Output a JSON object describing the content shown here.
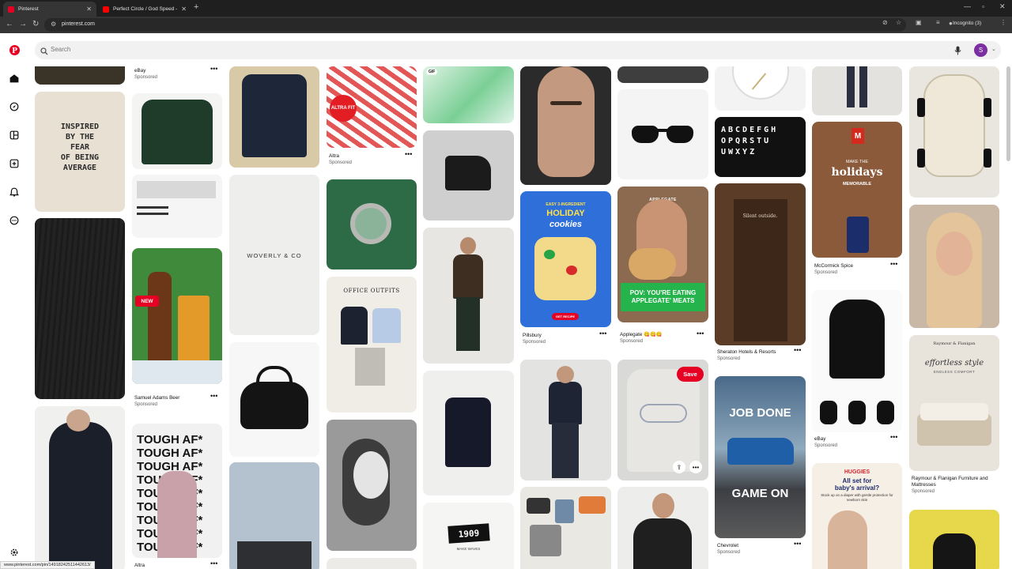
{
  "browser": {
    "tabs": [
      {
        "title": "Pinterest",
        "active": true
      },
      {
        "title": "Perfect Circle / God Speed - Yo",
        "active": false
      }
    ],
    "url": "pinterest.com",
    "incognito_label": "Incognito (3)",
    "status_url": "www.pinterest.com/pin/14918242511442613/"
  },
  "search": {
    "placeholder": "Search"
  },
  "user": {
    "initial": "S"
  },
  "pins": {
    "ebay_top": {
      "title": "eBay",
      "sub": "Sponsored"
    },
    "inspired": {
      "line1": "INSPIRED",
      "line2": "BY THE",
      "line3": "FEAR",
      "line4": "OF BEING",
      "line5": "AVERAGE"
    },
    "sam_adams": {
      "title": "Samuel Adams Beer",
      "sub": "Sponsored",
      "badge": "NEW"
    },
    "woverly": {
      "text": "WOVERLY & CO"
    },
    "altra_fit": {
      "title": "Altra",
      "sub": "Sponsored",
      "badge": "ALTRA FIT"
    },
    "office": {
      "title": "OFFICE OUTFITS"
    },
    "gif": {
      "badge": "GIF"
    },
    "pillsbury": {
      "title": "Pillsbury",
      "sub": "Sponsored",
      "line1": "EASY 3-INGREDIENT",
      "line2": "HOLIDAY",
      "line3": "cookies",
      "cta": "GET RECIPE"
    },
    "applegate": {
      "title": "Applegate 😋😋😋",
      "sub": "Sponsored",
      "caption": "POV: YOU'RE EATING APPLEGATE' MEATS",
      "brand": "APPLEGATE"
    },
    "save_label": "Save",
    "sheraton": {
      "title": "Sheraton Hotels & Resorts",
      "sub": "Sponsored",
      "sign": "Silent outside."
    },
    "chevrolet": {
      "title": "Chevrolet",
      "sub": "Sponsored",
      "line1": "JOB DONE",
      "line2": "GAME ON"
    },
    "mccormick": {
      "title": "McCormick Spice",
      "sub": "Sponsored",
      "line1": "MAKE THE",
      "line2": "holidays",
      "line3": "MEMORABLE"
    },
    "ebay_hoodie": {
      "title": "eBay",
      "sub": "Sponsored"
    },
    "huggies": {
      "brand": "HUGGIES",
      "line1": "All set for",
      "line2": "baby's arrival?",
      "line3": "Stock up on a diaper with gentle protection for newborn skin"
    },
    "raymour": {
      "title": "Raymour & Flanigan Furniture and Mattresses",
      "sub": "Sponsored",
      "brand": "Raymour & Flanigan",
      "line1": "effortless style",
      "line2": "ENDLESS COMFORT"
    },
    "tough": {
      "title": "Altra",
      "word": "TOUGH AF*"
    },
    "ninety": {
      "text": "1909",
      "sub": "MAKE WAVES"
    }
  },
  "colors": {
    "brand": "#e60023",
    "avatar": "#7b2fa0"
  }
}
